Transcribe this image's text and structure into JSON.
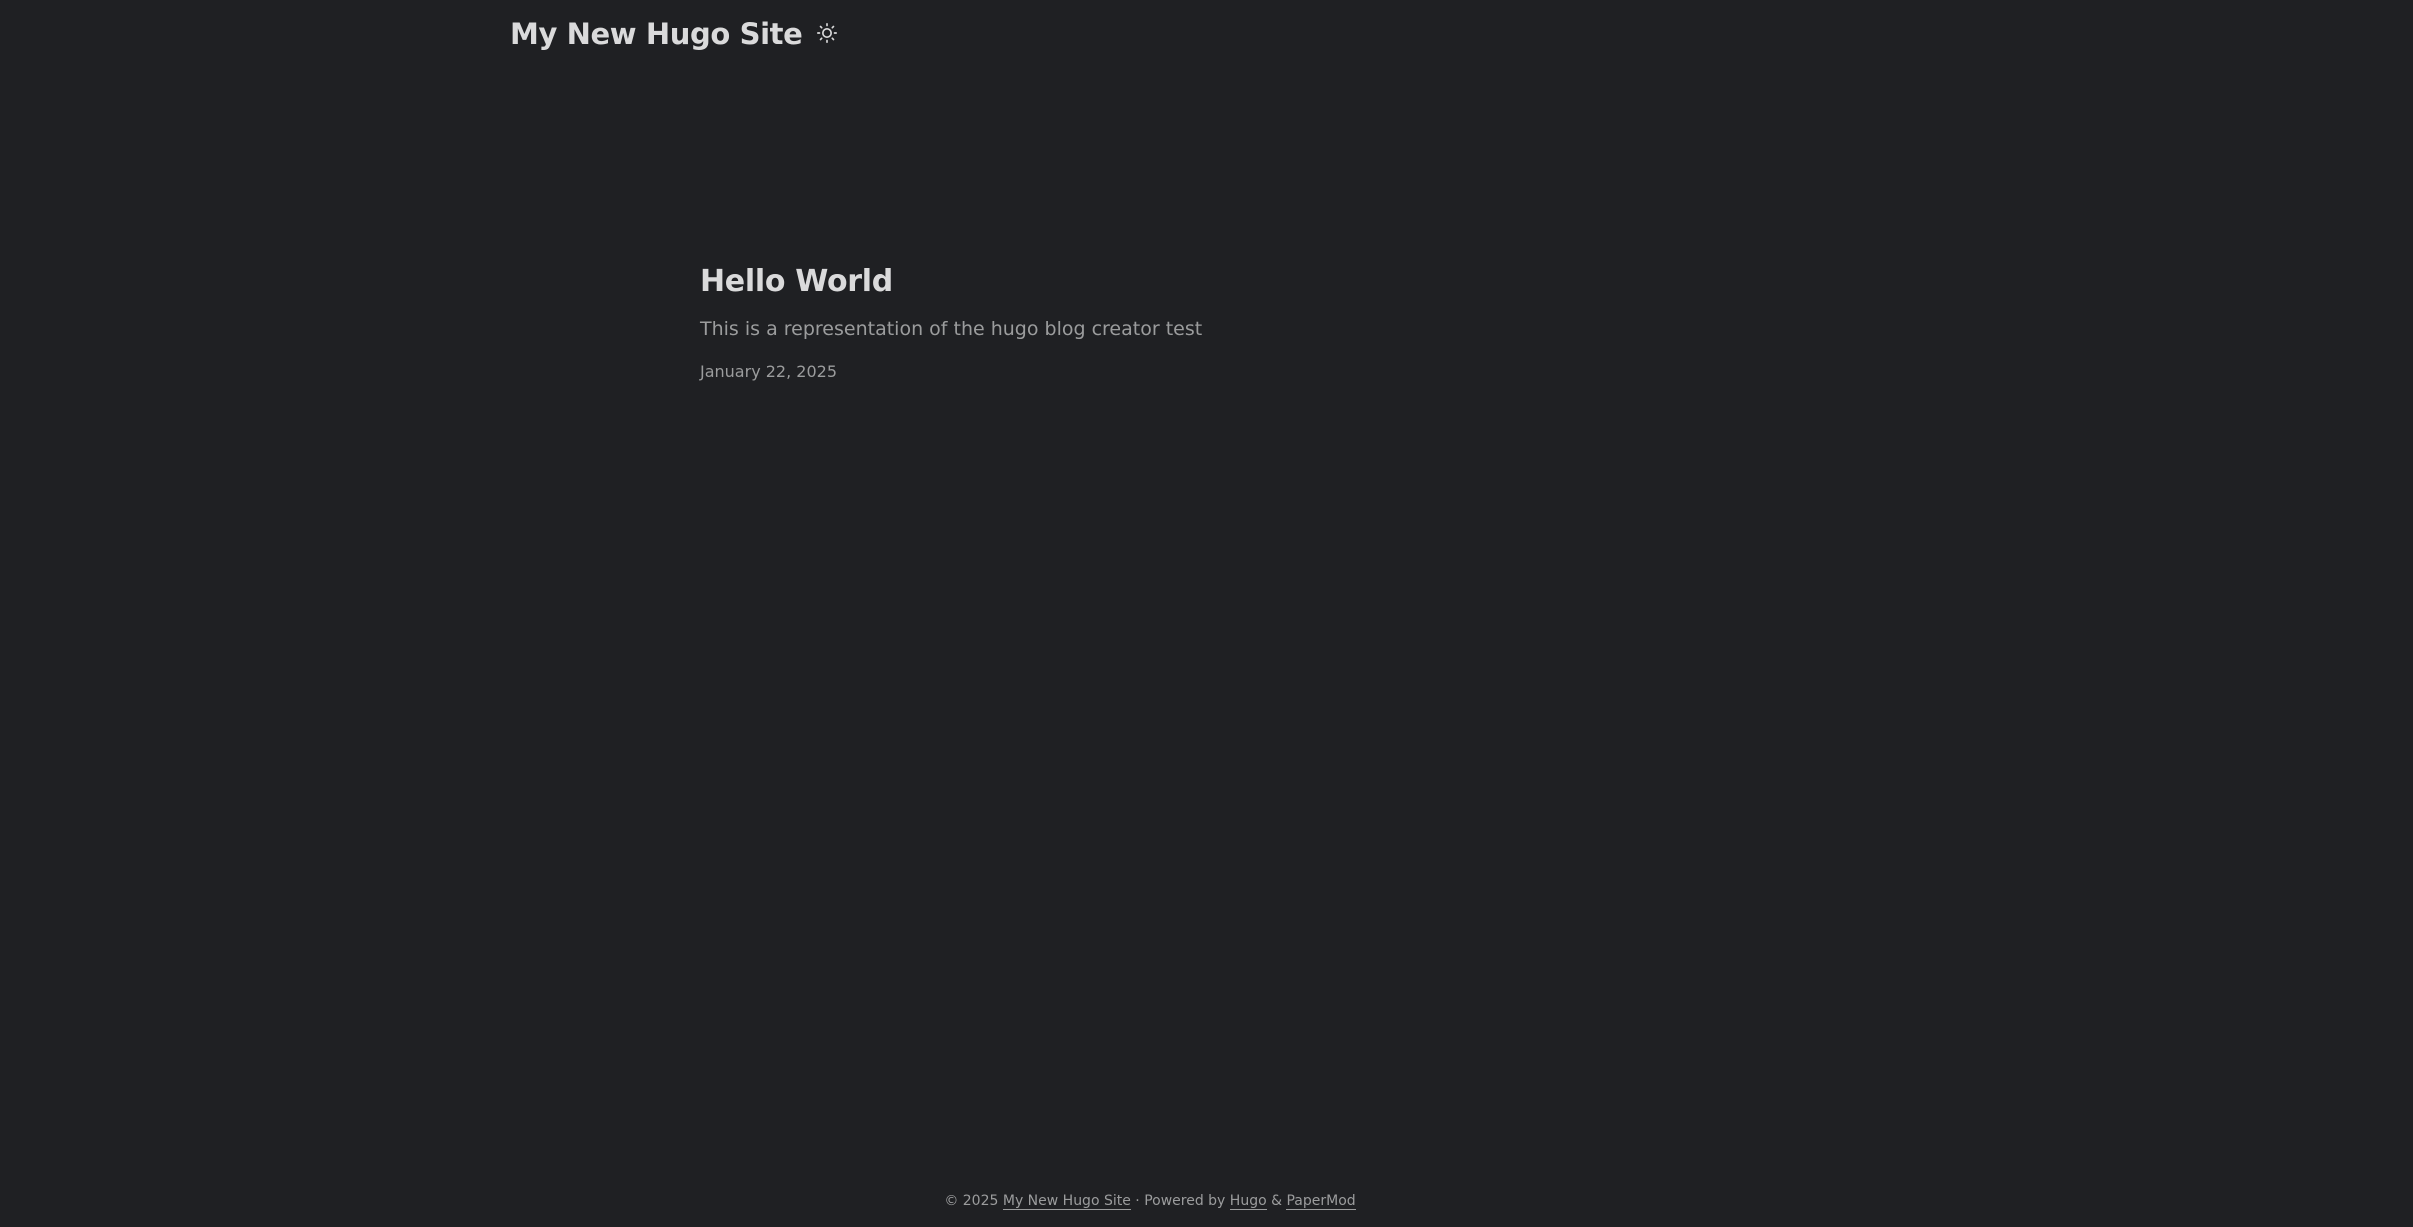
{
  "header": {
    "site_title": "My New Hugo Site",
    "theme_toggle_icon": "sun-icon"
  },
  "posts": [
    {
      "title": "Hello World",
      "summary": "This is a representation of the hugo blog creator test",
      "date": "January 22, 2025"
    }
  ],
  "footer": {
    "copyright": "© 2025",
    "site_link": "My New Hugo Site",
    "powered_by": "· Powered by",
    "hugo_link": "Hugo",
    "ampersand": "&",
    "papermod_link": "PaperMod"
  },
  "colors": {
    "background": "#1f2023",
    "primary_text": "#dadadb",
    "secondary_text": "#9b9c9d"
  }
}
